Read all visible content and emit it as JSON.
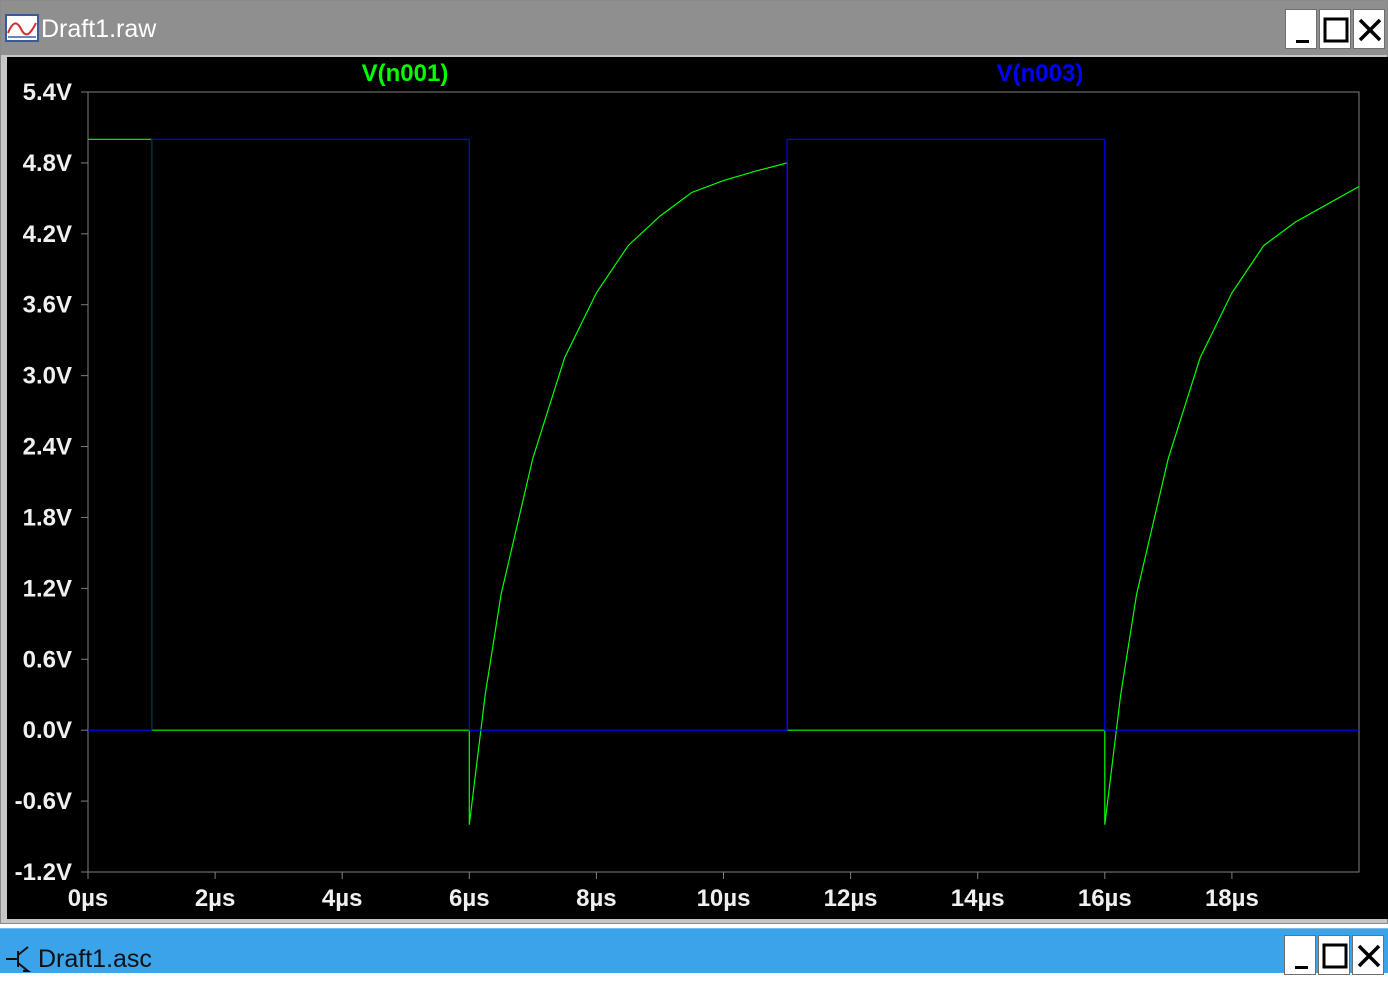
{
  "window": {
    "title": "Draft1.raw",
    "controls": {
      "minimize": "minimize",
      "maximize": "maximize",
      "close": "close"
    }
  },
  "window2": {
    "title": "Draft1.asc"
  },
  "colors": {
    "plot_background": "#000000",
    "axis": "#7f7f7f",
    "tick_text": "#f0f0f0",
    "series_n001": "#00ff00",
    "series_n003": "#0000ff"
  },
  "chart_data": {
    "type": "line",
    "title": "",
    "xlabel": "",
    "ylabel": "",
    "xlim": [
      0,
      20
    ],
    "ylim": [
      -1.2,
      5.4
    ],
    "grid": false,
    "x_ticks": [
      {
        "value": 0,
        "label": "0µs"
      },
      {
        "value": 2,
        "label": "2µs"
      },
      {
        "value": 4,
        "label": "4µs"
      },
      {
        "value": 6,
        "label": "6µs"
      },
      {
        "value": 8,
        "label": "8µs"
      },
      {
        "value": 10,
        "label": "10µs"
      },
      {
        "value": 12,
        "label": "12µs"
      },
      {
        "value": 14,
        "label": "14µs"
      },
      {
        "value": 16,
        "label": "16µs"
      },
      {
        "value": 18,
        "label": "18µs"
      }
    ],
    "y_ticks": [
      {
        "value": 5.4,
        "label": "5.4V"
      },
      {
        "value": 4.8,
        "label": "4.8V"
      },
      {
        "value": 4.2,
        "label": "4.2V"
      },
      {
        "value": 3.6,
        "label": "3.6V"
      },
      {
        "value": 3.0,
        "label": "3.0V"
      },
      {
        "value": 2.4,
        "label": "2.4V"
      },
      {
        "value": 1.8,
        "label": "1.8V"
      },
      {
        "value": 1.2,
        "label": "1.2V"
      },
      {
        "value": 0.6,
        "label": "0.6V"
      },
      {
        "value": 0.0,
        "label": "0.0V"
      },
      {
        "value": -0.6,
        "label": "-0.6V"
      },
      {
        "value": -1.2,
        "label": "-1.2V"
      }
    ],
    "series": [
      {
        "name": "V(n001)",
        "color": "#00ff00",
        "x": [
          0,
          1,
          1,
          6,
          6,
          6.25,
          6.5,
          7,
          7.5,
          8,
          8.5,
          9,
          9.5,
          10,
          10.5,
          11,
          11,
          16,
          16,
          16.25,
          16.5,
          17,
          17.5,
          18,
          18.5,
          19,
          19.5,
          20
        ],
        "y": [
          5.0,
          5.0,
          0.0,
          0.0,
          -0.8,
          0.3,
          1.15,
          2.3,
          3.15,
          3.7,
          4.1,
          4.35,
          4.55,
          4.65,
          4.73,
          4.8,
          0.0,
          0.0,
          -0.8,
          0.3,
          1.15,
          2.3,
          3.15,
          3.7,
          4.1,
          4.3,
          4.45,
          4.6
        ]
      },
      {
        "name": "V(n003)",
        "color": "#0000ff",
        "x": [
          0,
          1,
          1,
          6,
          6,
          11,
          11,
          16,
          16,
          20
        ],
        "y": [
          0.0,
          0.0,
          5.0,
          5.0,
          0.0,
          0.0,
          5.0,
          5.0,
          0.0,
          0.0
        ]
      }
    ]
  }
}
